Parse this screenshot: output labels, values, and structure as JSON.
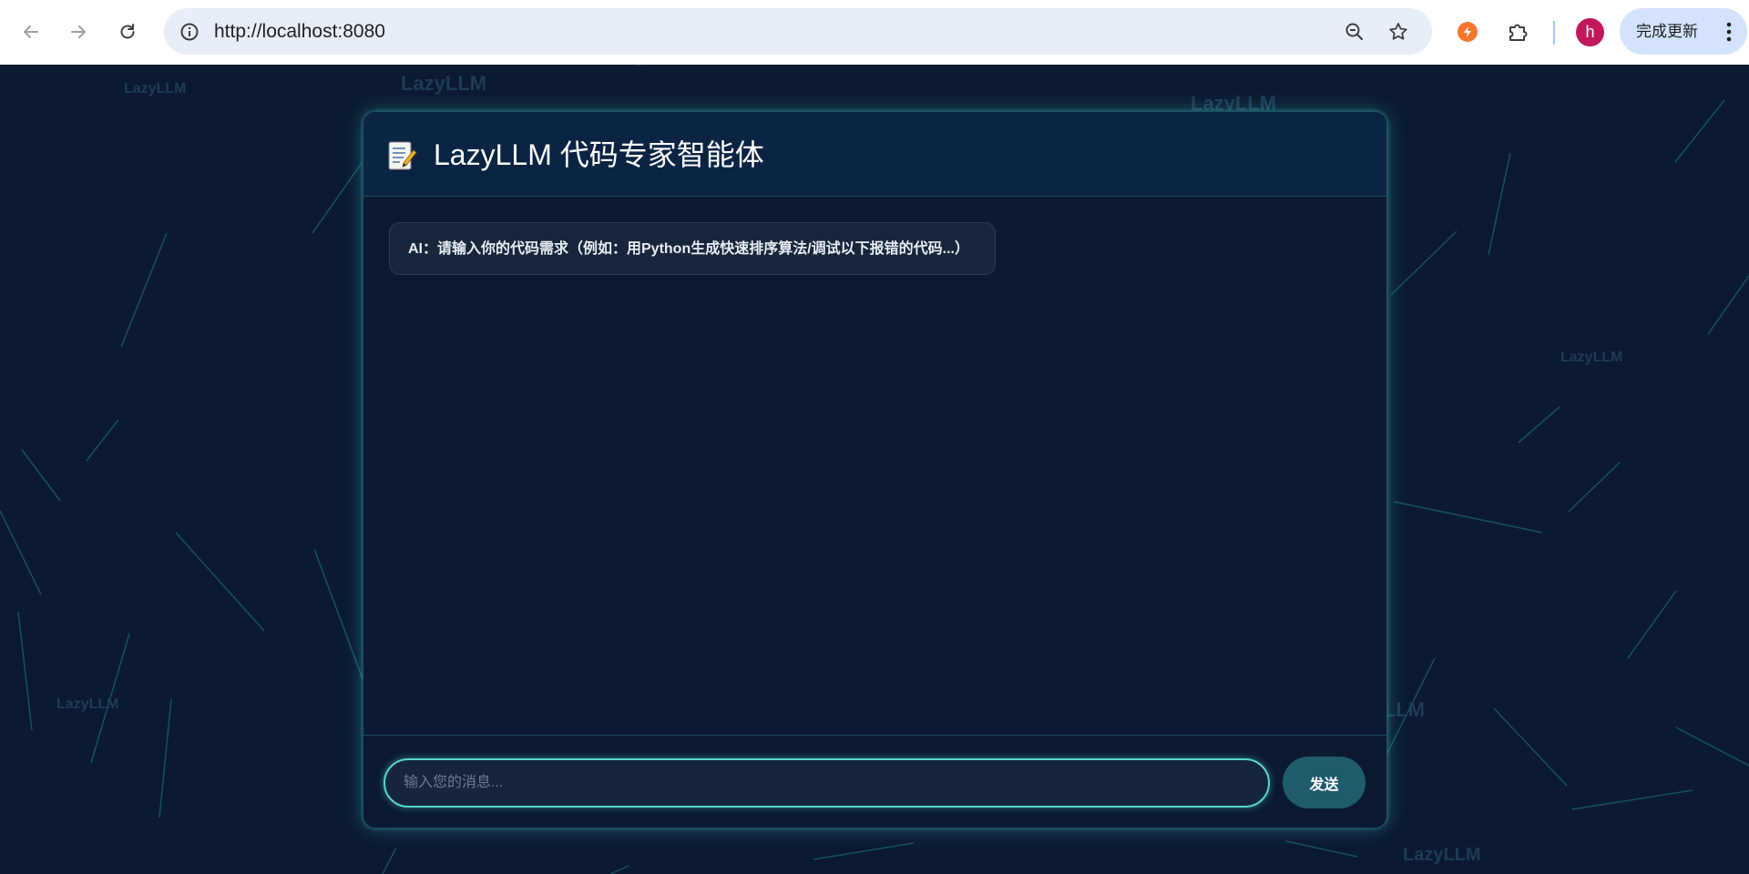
{
  "browser": {
    "url": "http://localhost:8080",
    "update_button_label": "完成更新",
    "avatar_letter": "h",
    "icons": {
      "back": "back-arrow-icon",
      "forward": "forward-arrow-icon",
      "reload": "reload-icon",
      "site_info": "site-info-icon",
      "zoom": "zoom-out-icon",
      "bookmark": "star-icon",
      "extension_app": "orange-extension-icon",
      "extensions": "puzzle-icon",
      "menu": "kebab-menu-icon"
    }
  },
  "background": {
    "watermark_text": "LazyLLM",
    "color": "#0b1a30",
    "line_color": "#1f6f7a"
  },
  "chat": {
    "title_icon": "memo-icon",
    "title": "LazyLLM 代码专家智能体",
    "messages": [
      {
        "role": "ai",
        "text": "AI：请输入你的代码需求（例如：用Python生成快速排序算法/调试以下报错的代码...）"
      }
    ],
    "input": {
      "value": "",
      "placeholder": "输入您的消息..."
    },
    "send_label": "发送",
    "accent_color": "#57d6c8"
  }
}
